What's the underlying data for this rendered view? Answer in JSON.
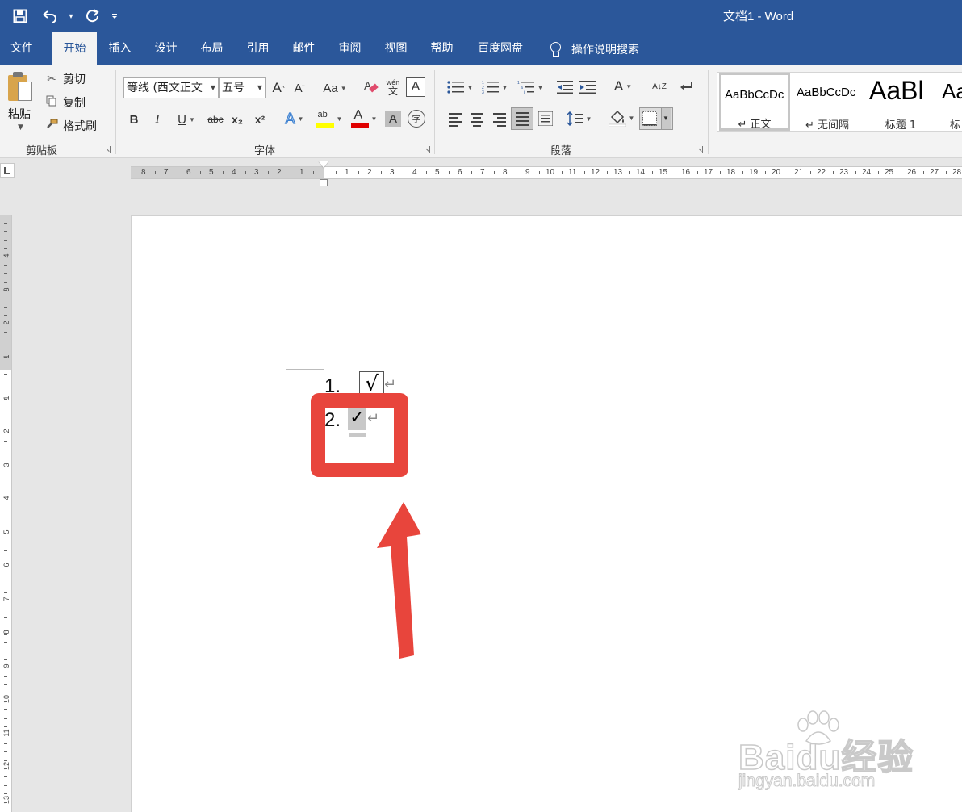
{
  "window": {
    "title": "文档1  -  Word"
  },
  "quick_access": {
    "save_icon": "save-icon",
    "undo_icon": "undo-icon",
    "redo_icon": "redo-icon",
    "customize_icon": "customize-qat-icon"
  },
  "tabs": [
    {
      "label": "文件"
    },
    {
      "label": "开始"
    },
    {
      "label": "插入"
    },
    {
      "label": "设计"
    },
    {
      "label": "布局"
    },
    {
      "label": "引用"
    },
    {
      "label": "邮件"
    },
    {
      "label": "审阅"
    },
    {
      "label": "视图"
    },
    {
      "label": "帮助"
    },
    {
      "label": "百度网盘"
    }
  ],
  "tell_me": {
    "label": "操作说明搜索"
  },
  "clipboard": {
    "paste": "粘贴",
    "cut": "剪切",
    "copy": "复制",
    "format_painter": "格式刷",
    "group_label": "剪贴板"
  },
  "font": {
    "font_name": "等线 (西文正文",
    "font_size": "五号",
    "group_label": "字体",
    "bold": "B",
    "italic": "I",
    "underline": "U",
    "strikethrough": "abc",
    "subscript": "x₂",
    "superscript": "x²",
    "change_case": "Aa",
    "grow": "A",
    "shrink": "A",
    "phonetic_top": "wén",
    "phonetic_bottom": "文",
    "char_border": "A",
    "font_color": "A",
    "char_shading": "A",
    "text_effects": "A",
    "highlight": "ab",
    "enclose": "字"
  },
  "paragraph": {
    "group_label": "段落",
    "sort": "A↓Z",
    "asian_layout": "A"
  },
  "styles": [
    {
      "preview": "AaBbCcDc",
      "name": "↵ 正文"
    },
    {
      "preview": "AaBbCcDc",
      "name": "↵ 无间隔"
    },
    {
      "preview": "AaBl",
      "name": "标题 1"
    },
    {
      "preview": "Aa",
      "name": "标"
    }
  ],
  "ruler": {
    "left_numbers": [
      "8",
      "7",
      "6",
      "5",
      "4",
      "3",
      "2",
      "1"
    ],
    "right_numbers": [
      "1",
      "2",
      "3",
      "4",
      "5",
      "6",
      "7",
      "8",
      "9",
      "10",
      "11",
      "12",
      "13",
      "14",
      "15",
      "16",
      "17",
      "18",
      "19",
      "20",
      "21",
      "22",
      "23",
      "24",
      "25",
      "26",
      "27",
      "28"
    ],
    "vertical_top": [
      "4",
      "3",
      "2",
      "1"
    ],
    "vertical_bottom": [
      "1",
      "2",
      "3",
      "4",
      "5",
      "6",
      "7",
      "8",
      "9",
      "10",
      "11",
      "12",
      "13"
    ]
  },
  "document": {
    "line1_number": "1.",
    "line1_symbol": "√",
    "line2_number": "2.",
    "line2_symbol": "✓",
    "paragraph_mark": "↵"
  },
  "watermark": {
    "brand": "Baidu经验",
    "url": "jingyan.baidu.com"
  },
  "colors": {
    "word_blue": "#2b579a",
    "highlight_red": "#e8453c",
    "ribbon_bg": "#f3f3f3"
  }
}
